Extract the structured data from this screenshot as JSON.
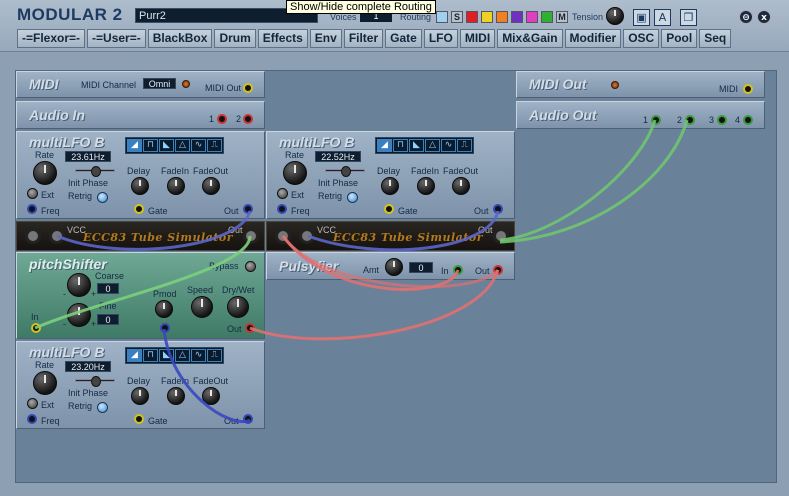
{
  "app": {
    "title": "MODULAR 2",
    "preset_name": "Purr2",
    "tooltip": "Show/Hide complete Routing",
    "voices_label": "Voices",
    "voices_value": "1",
    "routing_label": "Routing",
    "tension_label": "Tension",
    "routing_letters": {
      "s": "S",
      "m": "M"
    },
    "routing_colors": [
      "#9fd0f0",
      "#e02020",
      "#f0d020",
      "#f08020",
      "#7030c0",
      "#e040c0",
      "#30b030"
    ],
    "toolbar_icons": [
      "save-icon",
      "save-as-icon",
      "copy-icon"
    ],
    "window_buttons": {
      "minimize": "⊖",
      "close": "x"
    }
  },
  "tabs": [
    "-=Flexor=-",
    "-=User=-",
    "BlackBox",
    "Drum",
    "Effects",
    "Env",
    "Filter",
    "Gate",
    "LFO",
    "MIDI",
    "Mix&Gain",
    "Modifier",
    "OSC",
    "Pool",
    "Seq"
  ],
  "modules": {
    "midi": {
      "title": "MIDI",
      "channel_label": "MIDI Channel",
      "channel_value": "Omni",
      "out_label": "MIDI Out"
    },
    "audio_in": {
      "title": "Audio In",
      "ports": [
        "1",
        "2"
      ]
    },
    "midi_out": {
      "title": "MIDI Out",
      "port_label": "MIDI"
    },
    "audio_out": {
      "title": "Audio Out",
      "ports": [
        "1",
        "2",
        "3",
        "4"
      ]
    },
    "lfo1": {
      "title": "multiLFO B",
      "rate_label": "Rate",
      "rate_value": "23.61Hz",
      "ext_label": "Ext",
      "init_phase_label": "Init Phase",
      "retrig_label": "Retrig",
      "delay_label": "Delay",
      "fadein_label": "FadeIn",
      "fadeout_label": "FadeOut",
      "freq_label": "Freq",
      "gate_label": "Gate",
      "out_label": "Out"
    },
    "lfo2": {
      "title": "multiLFO B",
      "rate_label": "Rate",
      "rate_value": "22.52Hz",
      "ext_label": "Ext",
      "init_phase_label": "Init Phase",
      "retrig_label": "Retrig",
      "delay_label": "Delay",
      "fadein_label": "FadeIn",
      "fadeout_label": "FadeOut",
      "freq_label": "Freq",
      "gate_label": "Gate",
      "out_label": "Out"
    },
    "lfo3": {
      "title": "multiLFO B",
      "rate_label": "Rate",
      "rate_value": "23.20Hz",
      "ext_label": "Ext",
      "init_phase_label": "Init Phase",
      "retrig_label": "Retrig",
      "delay_label": "Delay",
      "fadein_label": "FadeIn",
      "fadeout_label": "FadeOut",
      "freq_label": "Freq",
      "gate_label": "Gate",
      "out_label": "Out"
    },
    "tube1": {
      "title": "ECC83 Tube Simulator",
      "vcc_label": "VCC",
      "out_label": "Out"
    },
    "tube2": {
      "title": "ECC83 Tube Simulator",
      "vcc_label": "VCC",
      "out_label": "Out"
    },
    "pitch": {
      "title": "pitchShifter",
      "bypass_label": "Bypass",
      "coarse_label": "Coarse",
      "coarse_value": "0",
      "fine_label": "Fine",
      "fine_value": "0",
      "minus": "-",
      "plus": "+",
      "pmod_label": "Pmod",
      "speed_label": "Speed",
      "drywet_label": "Dry/Wet",
      "in_label": "In",
      "out_label": "Out"
    },
    "pulsyfier": {
      "title": "Pulsyfier",
      "amt_label": "Amt",
      "amt_value": "0",
      "in_label": "In",
      "out_label": "Out"
    }
  },
  "waveforms": [
    "saw-wave-icon",
    "square-wave-icon",
    "ramp-wave-icon",
    "triangle-wave-icon",
    "sine-wave-icon",
    "pulse-wave-icon"
  ],
  "waveform_glyphs": [
    "◢",
    "⊓",
    "◣",
    "△",
    "∿",
    "⎍"
  ]
}
